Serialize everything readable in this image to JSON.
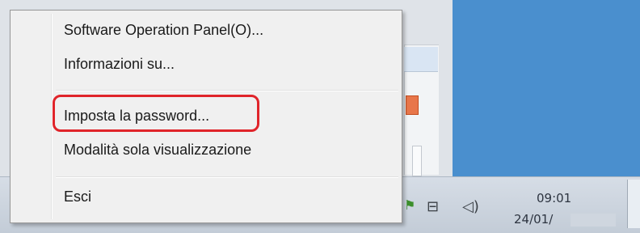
{
  "menu": {
    "items": [
      {
        "label": "Software Operation Panel(O)..."
      },
      {
        "label": "Informazioni su..."
      },
      {
        "label": "Imposta la password..."
      },
      {
        "label": "Modalità sola visualizzazione"
      },
      {
        "label": "Esci"
      }
    ],
    "highlight_color": "#e0242a"
  },
  "taskbar": {
    "clock_time": "09:01",
    "clock_date": "24/01/",
    "tray_icons": [
      "action-center-flag-icon",
      "network-icon",
      "volume-icon"
    ]
  },
  "colors": {
    "desktop": "#4a8fce",
    "menu_background": "#f0f0f0"
  }
}
